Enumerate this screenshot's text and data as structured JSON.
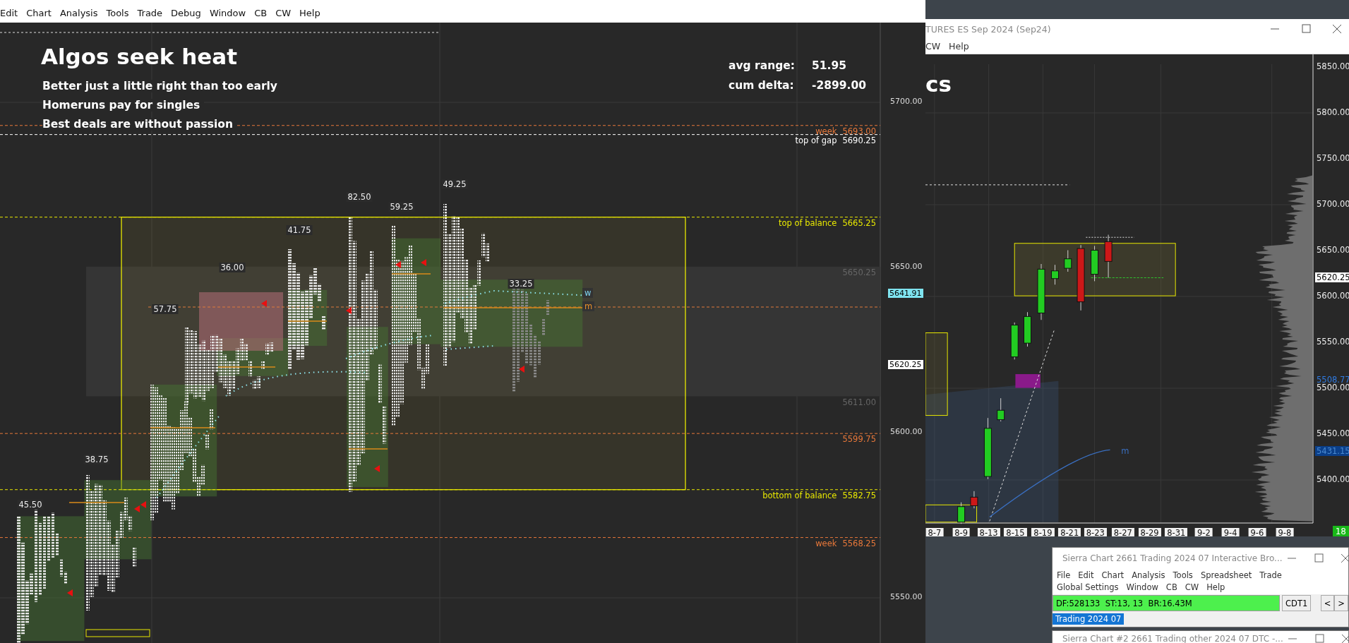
{
  "main_window": {
    "menu": [
      "Edit",
      "Chart",
      "Analysis",
      "Tools",
      "Trade",
      "Debug",
      "Window",
      "CB",
      "CW",
      "Help"
    ],
    "heading": "Algos seek heat",
    "notes": [
      "Better just a little right than too early",
      "Homeruns pay for singles",
      "Best deals are without passion"
    ],
    "stats": [
      {
        "label": "avg range:",
        "value": "51.95"
      },
      {
        "label": "cum delta:",
        "value": "-2899.00"
      }
    ],
    "price_axis": [
      "5700.00",
      "5650.00",
      "5600.00",
      "5550.00"
    ],
    "level_lines": [
      {
        "label": "week",
        "price": "5693.00",
        "kind": "week"
      },
      {
        "label": "top of gap",
        "price": "5690.25",
        "kind": "gap"
      },
      {
        "label": "top of balance",
        "price": "5665.25",
        "kind": "balance"
      },
      {
        "price": "5650.25",
        "kind": "band"
      },
      {
        "price": "5611.00",
        "kind": "band"
      },
      {
        "price": "5599.75",
        "kind": "level"
      },
      {
        "label": "bottom of balance",
        "price": "5582.75",
        "kind": "balance"
      },
      {
        "label": "week",
        "price": "5568.25",
        "kind": "week"
      }
    ],
    "price_markers": [
      {
        "price": "5641.91",
        "kind": "vwap"
      },
      {
        "price": "5620.25",
        "kind": "last"
      }
    ],
    "profile_ranges": [
      "45.50",
      "38.75",
      "57.75",
      "36.00",
      "41.75",
      "82.50",
      "59.25",
      "49.25",
      "33.25"
    ],
    "value_area_tags": [
      "w",
      "m"
    ]
  },
  "side_window": {
    "title": "TURES ES Sep 2024 (Sep24)",
    "menu": [
      "CW",
      "Help"
    ],
    "heading_fragment": "cs",
    "price_axis": [
      "5850.00",
      "5800.00",
      "5750.00",
      "5700.00",
      "5650.00",
      "5600.00",
      "5550.00",
      "5500.00",
      "5450.00",
      "5400.00"
    ],
    "price_markers": [
      {
        "price": "5620.25",
        "kind": "last"
      },
      {
        "price": "5508.77",
        "kind": "line"
      },
      {
        "price": "5431.15",
        "kind": "box"
      }
    ],
    "line_tag": "m",
    "date_axis": [
      "8-7",
      "8-9",
      "8-13",
      "8-15",
      "8-19",
      "8-21",
      "8-23",
      "8-27",
      "8-29",
      "8-31",
      "9-2",
      "9-4",
      "9-6",
      "9-8"
    ],
    "bar_counter": "18"
  },
  "trading_window": {
    "title": "Sierra Chart 2661 Trading 2024 07 Interactive Bro...",
    "menu": [
      "File",
      "Edit",
      "Chart",
      "Analysis",
      "Tools",
      "Spreadsheet",
      "Trade",
      "Global Settings",
      "Window",
      "CB",
      "CW",
      "Help"
    ],
    "status": "DF:528133  ST:13, 13  BR:16.43M",
    "time_zone_button": "CDT1",
    "nav_buttons": [
      "<",
      ">"
    ],
    "tabs": [
      {
        "label": "Trading 2024 07",
        "selected": true
      }
    ]
  },
  "other_window": {
    "title": "Sierra Chart #2 2661 Trading other 2024 07 DTC -..."
  }
}
